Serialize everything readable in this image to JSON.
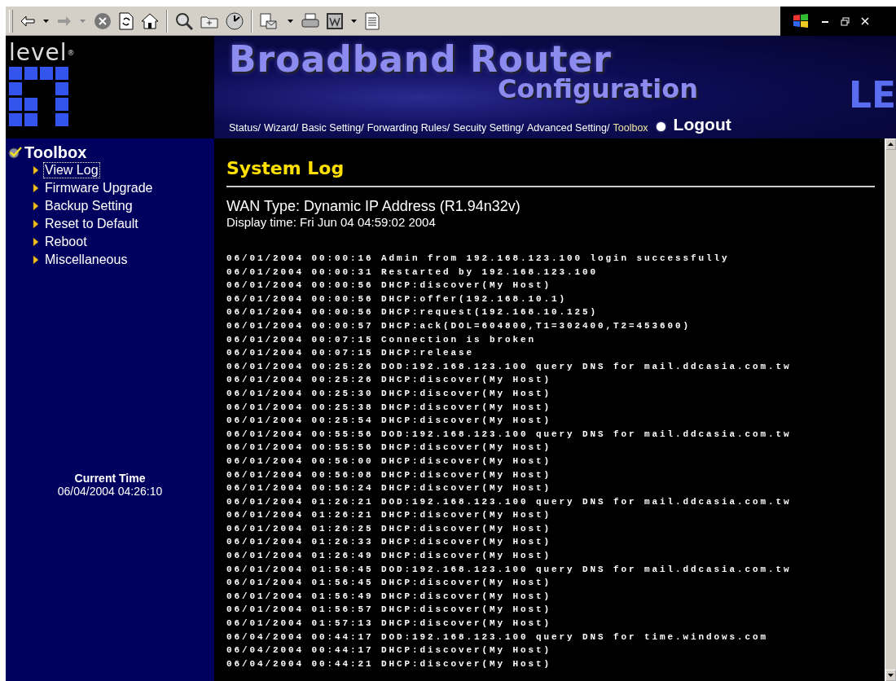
{
  "header": {
    "logo": "level$^{®}$",
    "banner_title": "Broadband Router",
    "banner_subtitle": "Configuration",
    "brand": "LE",
    "nav": [
      {
        "label": "Status/",
        "selected": false
      },
      {
        "label": "Wizard/",
        "selected": false
      },
      {
        "label": "Basic Setting/",
        "selected": false
      },
      {
        "label": "Forwarding Rules/",
        "selected": false
      },
      {
        "label": "Secuity Setting/",
        "selected": false
      },
      {
        "label": "Advanced Setting/",
        "selected": false
      },
      {
        "label": "Toolbox",
        "selected": true
      }
    ],
    "logout": "Logout"
  },
  "sidebar": {
    "section": "Toolbox",
    "items": [
      {
        "label": "View Log",
        "selected": true
      },
      {
        "label": "Firmware Upgrade",
        "selected": false
      },
      {
        "label": "Backup Setting",
        "selected": false
      },
      {
        "label": "Reset to Default",
        "selected": false
      },
      {
        "label": "Reboot",
        "selected": false
      },
      {
        "label": "Miscellaneous",
        "selected": false
      }
    ],
    "current_time": {
      "label": "Current Time",
      "value": "06/04/2004 04:26:10"
    }
  },
  "main": {
    "title": "System Log",
    "wan_type": "WAN Type: Dynamic IP Address (R1.94n32v)",
    "display_time": "Display time: Fri Jun 04 04:59:02 2004",
    "log": [
      "06/01/2004 00:00:16 Admin from 192.168.123.100 login successfully",
      "06/01/2004 00:00:31 Restarted by 192.168.123.100",
      "06/01/2004 00:00:56 DHCP:discover(My Host)",
      "06/01/2004 00:00:56 DHCP:offer(192.168.10.1)",
      "06/01/2004 00:00:56 DHCP:request(192.168.10.125)",
      "06/01/2004 00:00:57 DHCP:ack(DOL=604800,T1=302400,T2=453600)",
      "06/01/2004 00:07:15 Connection is broken",
      "06/01/2004 00:07:15 DHCP:release",
      "06/01/2004 00:25:26 DOD:192.168.123.100 query DNS for mail.ddcasia.com.tw",
      "06/01/2004 00:25:26 DHCP:discover(My Host)",
      "06/01/2004 00:25:30 DHCP:discover(My Host)",
      "06/01/2004 00:25:38 DHCP:discover(My Host)",
      "06/01/2004 00:25:54 DHCP:discover(My Host)",
      "06/01/2004 00:55:56 DOD:192.168.123.100 query DNS for mail.ddcasia.com.tw",
      "06/01/2004 00:55:56 DHCP:discover(My Host)",
      "06/01/2004 00:56:00 DHCP:discover(My Host)",
      "06/01/2004 00:56:08 DHCP:discover(My Host)",
      "06/01/2004 00:56:24 DHCP:discover(My Host)",
      "06/01/2004 01:26:21 DOD:192.168.123.100 query DNS for mail.ddcasia.com.tw",
      "06/01/2004 01:26:21 DHCP:discover(My Host)",
      "06/01/2004 01:26:25 DHCP:discover(My Host)",
      "06/01/2004 01:26:33 DHCP:discover(My Host)",
      "06/01/2004 01:26:49 DHCP:discover(My Host)",
      "06/01/2004 01:56:45 DOD:192.168.123.100 query DNS for mail.ddcasia.com.tw",
      "06/01/2004 01:56:45 DHCP:discover(My Host)",
      "06/01/2004 01:56:49 DHCP:discover(My Host)",
      "06/01/2004 01:56:57 DHCP:discover(My Host)",
      "06/01/2004 01:57:13 DHCP:discover(My Host)",
      "06/04/2004 00:44:17 DOD:192.168.123.100 query DNS for time.windows.com",
      "06/04/2004 00:44:17 DHCP:discover(My Host)",
      "06/04/2004 00:44:21 DHCP:discover(My Host)"
    ]
  }
}
